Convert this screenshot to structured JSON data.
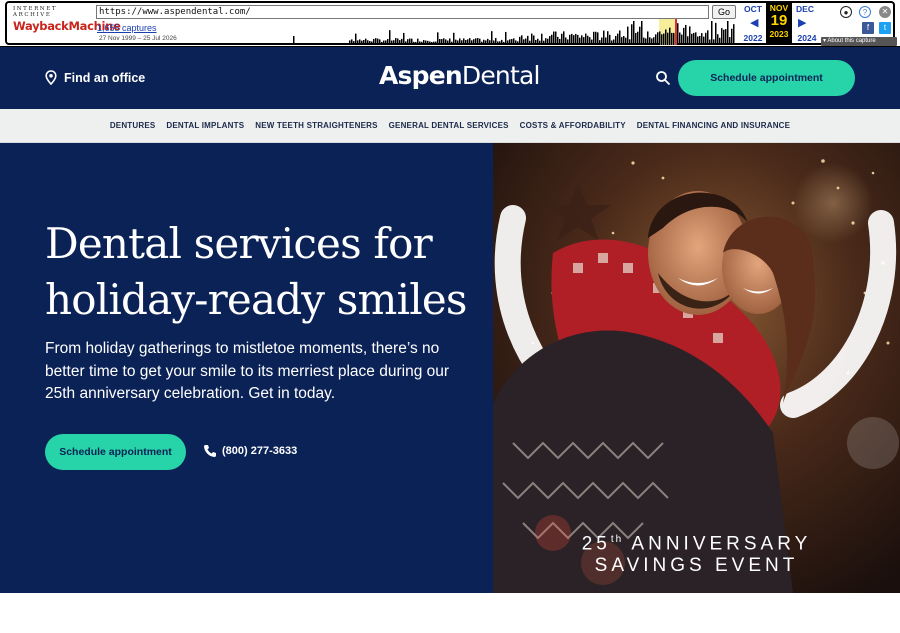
{
  "wayback": {
    "logo_top": "INTERNET ARCHIVE",
    "logo_main": "WaybackMachine",
    "url": "https://www.aspendental.com/",
    "go_label": "Go",
    "captures": "1,655 captures",
    "range": "27 Nov 1999 – 25 Jul 2026",
    "prev_month": "OCT",
    "cur_month": "NOV",
    "next_month": "DEC",
    "prev_year": "2022",
    "cur_day": "19",
    "cur_year": "2023",
    "next_year": "2024",
    "about": "About this capture"
  },
  "header": {
    "find_office": "Find an office",
    "logo_a": "Aspen",
    "logo_b": "Dental",
    "cta": "Schedule appointment"
  },
  "nav": {
    "items": [
      "DENTURES",
      "DENTAL IMPLANTS",
      "NEW TEETH STRAIGHTENERS",
      "GENERAL DENTAL SERVICES",
      "COSTS & AFFORDABILITY",
      "DENTAL FINANCING AND INSURANCE"
    ]
  },
  "hero": {
    "title": "Dental services for holiday-ready smiles",
    "body": "From holiday gatherings to mistletoe moments, there’s no better time to get your smile to its merriest place during our 25th anniversary celebration. Get in today.",
    "cta": "Schedule appointment",
    "phone": "(800) 277-3633",
    "anniv_num": "25",
    "anniv_sup": "th",
    "anniv_line1": "ANNIVERSARY",
    "anniv_line2": "SAVINGS EVENT"
  },
  "colors": {
    "navy": "#0b2256",
    "mint": "#27d3a8"
  }
}
